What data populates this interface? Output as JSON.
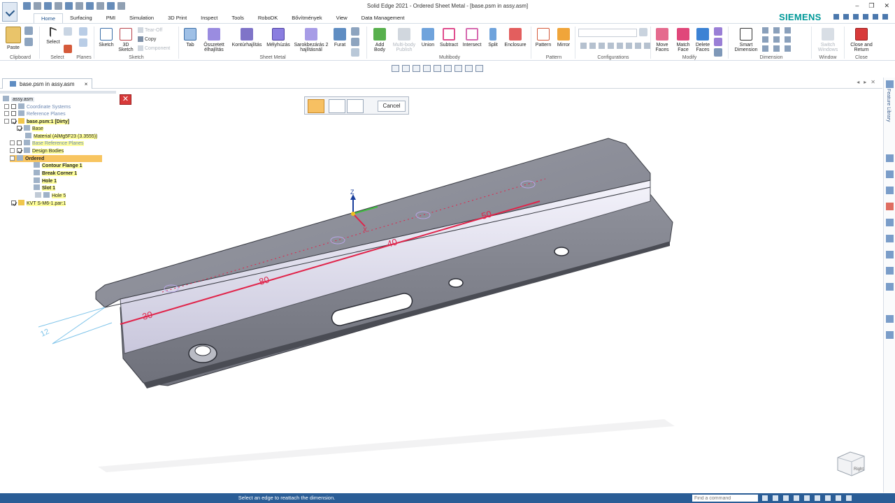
{
  "app": {
    "window_title": "Solid Edge 2021 - Ordered Sheet Metal - [base.psm in assy.asm]",
    "brand": "SIEMENS",
    "brand_color": "#009999",
    "accent": "#2a5d96"
  },
  "ribbon_tabs": [
    "Home",
    "Surfacing",
    "PMI",
    "Simulation",
    "3D Print",
    "Inspect",
    "Tools",
    "RoboDK",
    "Bővítmények",
    "View",
    "Data Management"
  ],
  "active_tab": "Home",
  "ribbon": {
    "paste": "Paste",
    "select": "Select",
    "sketch": "Sketch",
    "sketch3d_line1": "3D",
    "sketch3d_line2": "Sketch",
    "tear_off": "Tear-Off",
    "copy": "Copy",
    "component": "Component",
    "tab": "Tab",
    "osszetett_line1": "Összetett",
    "osszetett_line2": "élhajlítás",
    "konturhajlitas": "Kontúrhajlítás",
    "melyhuzas": "Mélyhúzás",
    "sarok_line1": "Sarokbezárás 2",
    "sarok_line2": "hajlításnál",
    "furat": "Furat",
    "add_body_line1": "Add",
    "add_body_line2": "Body",
    "multibody_publish_line1": "Multi-body",
    "multibody_publish_line2": "Publish",
    "union": "Union",
    "subtract": "Subtract",
    "intersect": "Intersect",
    "split": "Split",
    "enclosure": "Enclosure",
    "pattern": "Pattern",
    "mirror": "Mirror",
    "move_faces_line1": "Move",
    "move_faces_line2": "Faces",
    "match_face_line1": "Match",
    "match_face_line2": "Face",
    "delete_faces_line1": "Delete",
    "delete_faces_line2": "Faces",
    "smart_dim_line1": "Smart",
    "smart_dim_line2": "Dimension",
    "switch_windows_line1": "Switch",
    "switch_windows_line2": "Windows",
    "close_return_line1": "Close and",
    "close_return_line2": "Return",
    "groups": {
      "clipboard": "Clipboard",
      "select": "Select",
      "planes": "Planes",
      "sketch": "Sketch",
      "sheet_metal": "Sheet Metal",
      "multibody": "Multibody",
      "pattern": "Pattern",
      "configurations": "Configurations",
      "modify": "Modify",
      "dimension": "Dimension",
      "window": "Window",
      "close": "Close"
    }
  },
  "doc_tab": {
    "label": "base.psm in assy.asm",
    "close": "×"
  },
  "tree": {
    "root": "assy.asm",
    "coord_systems": "Coordinate Systems",
    "ref_planes": "Reference Planes",
    "part": "base.psm:1 [Dirty]",
    "base": "Base",
    "material": "Material (AlMg5F23  (3.3555))",
    "base_ref_planes": "Base Reference Planes",
    "design_bodies": "Design Bodies",
    "ordered": "Ordered",
    "contour_flange": "Contour Flange 1",
    "break_corner": "Break Corner 1",
    "hole1": "Hole 1",
    "slot1": "Slot 1",
    "hole5": "Hole 5",
    "kvt": "KVT S-M6-1.par:1"
  },
  "command_bar": {
    "cancel": "Cancel"
  },
  "right_panel": {
    "feature_library": "Feature Library"
  },
  "viewport": {
    "dim_labels": [
      "30",
      "80",
      "40",
      "50"
    ],
    "extra_dim": "12",
    "axis_z": "Z",
    "axis_x": "X",
    "view_cube_label": "Right"
  },
  "status": {
    "message": "Select an edge to reattach the dimension.",
    "find_placeholder": "Find a command"
  }
}
